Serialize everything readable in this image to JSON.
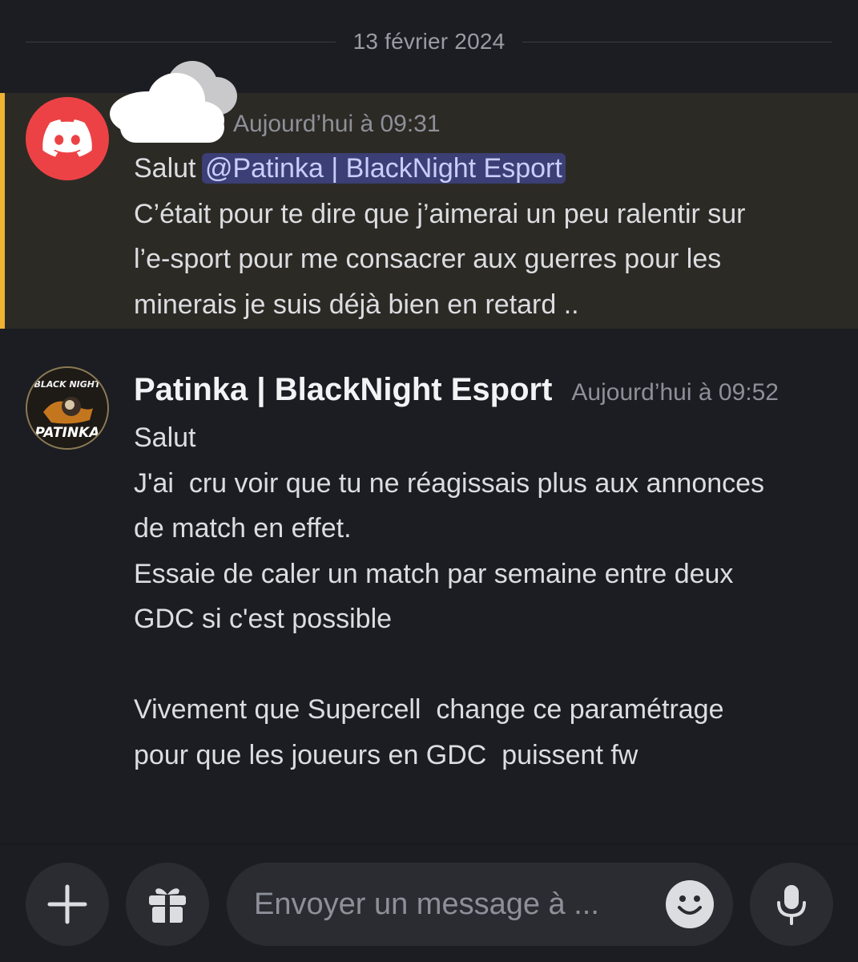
{
  "date_divider": "13 février 2024",
  "messages": [
    {
      "author": "",
      "timestamp": "Aujourd’hui à 09:31",
      "greeting": "Salut ",
      "mention": "@Patinka | BlackNight Esport",
      "text": "C’était pour te dire que j’aimerai un peu ralentir sur\nl’e-sport pour me consacrer aux guerres pour les\nminerais je suis déjà bien en retard ..",
      "avatar_icon": "discord-logo-icon",
      "highlight_color": "#f0b232"
    },
    {
      "author": "Patinka | BlackNight Esport",
      "timestamp": "Aujourd’hui à 09:52",
      "text": "Salut\nJ'ai  cru voir que tu ne réagissais plus aux annonces\nde match en effet.\nEssaie de caler un match par semaine entre deux\nGDC si c'est possible\n\nVivement que Supercell  change ce paramétrage\npour que les joueurs en GDC  puissent fw",
      "avatar_text_top": "BLACK NIGHT",
      "avatar_text_bottom": "PATINKA"
    }
  ],
  "composer": {
    "placeholder": "Envoyer un message à ...",
    "buttons": [
      "plus-icon",
      "gift-icon",
      "emoji-icon",
      "microphone-icon"
    ]
  },
  "colors": {
    "background": "#1c1d22",
    "mention_bg": "#3b3f75",
    "discord_red": "#ed4245"
  }
}
